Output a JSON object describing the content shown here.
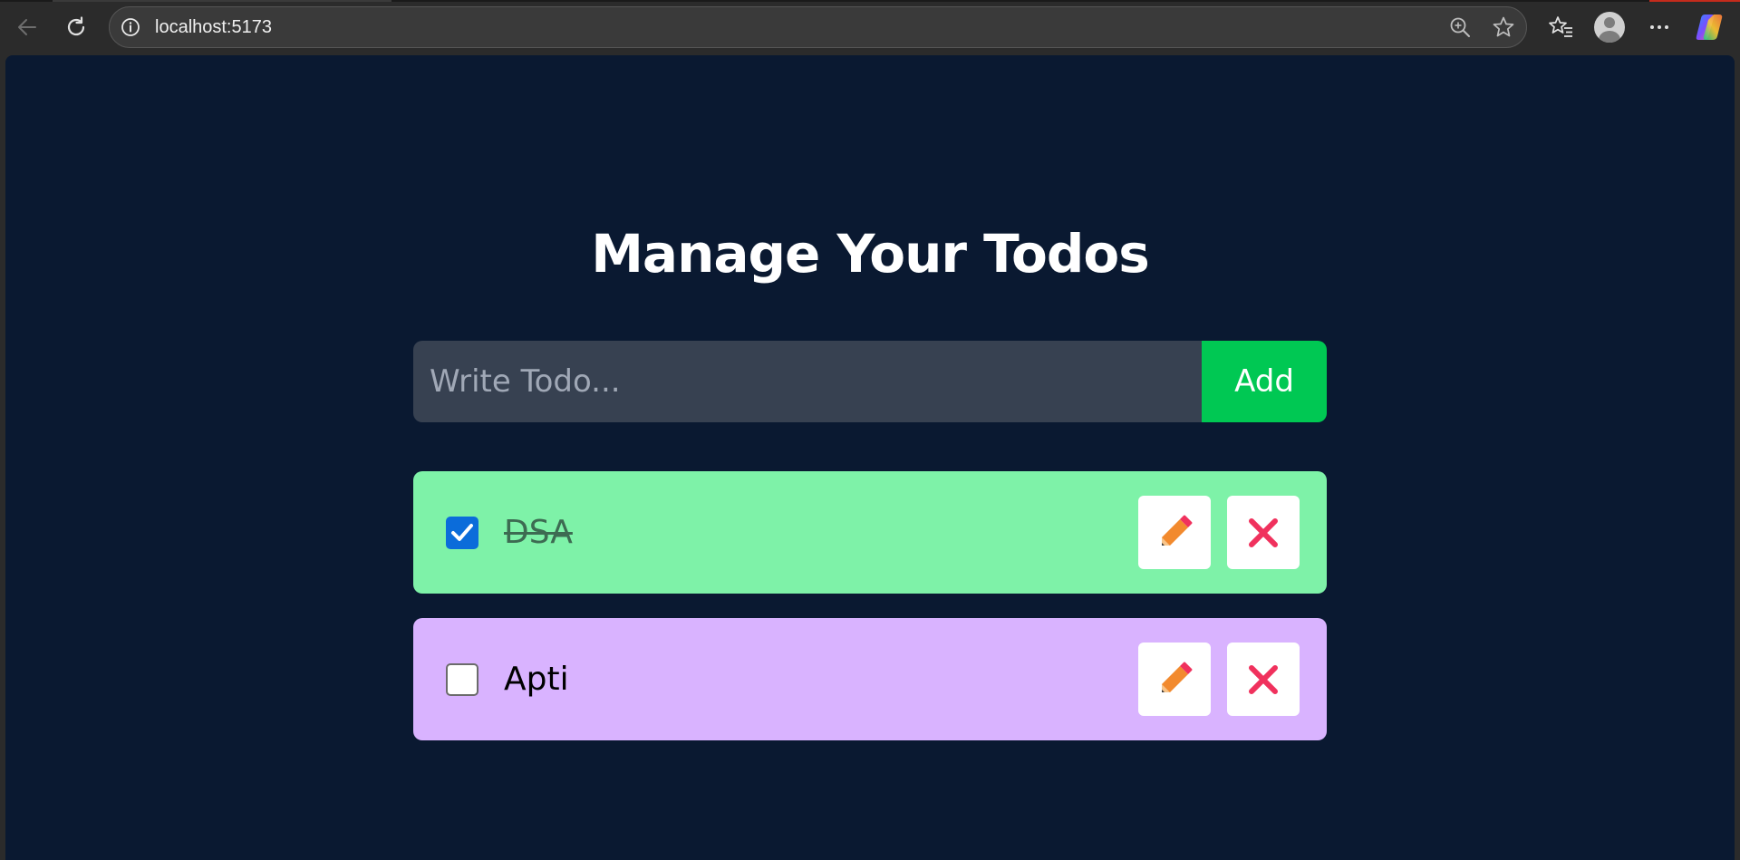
{
  "browser": {
    "url": "localhost:5173",
    "icons": {
      "back": "arrow-left-icon",
      "reload": "reload-icon",
      "info": "info-icon",
      "zoom": "zoom-icon",
      "favorite": "star-icon",
      "favorites_bar": "favorites-icon",
      "profile": "profile-icon",
      "more": "more-icon",
      "copilot": "copilot-icon"
    }
  },
  "app": {
    "title": "Manage Your Todos",
    "input_placeholder": "Write Todo...",
    "input_value": "",
    "add_label": "Add",
    "colors": {
      "background": "#0a1931",
      "input_bg": "#374151",
      "add_button": "#00c853",
      "done_item": "#7ef2a8",
      "pending_item": "#d9b3ff",
      "checkbox_checked": "#0b6cda",
      "delete_icon": "#f0315d",
      "edit_icon": "#f28a2e"
    },
    "todos": [
      {
        "text": "DSA",
        "completed": true,
        "edit_icon": "pencil-icon",
        "delete_icon": "close-icon"
      },
      {
        "text": "Apti",
        "completed": false,
        "edit_icon": "pencil-icon",
        "delete_icon": "close-icon"
      }
    ]
  }
}
